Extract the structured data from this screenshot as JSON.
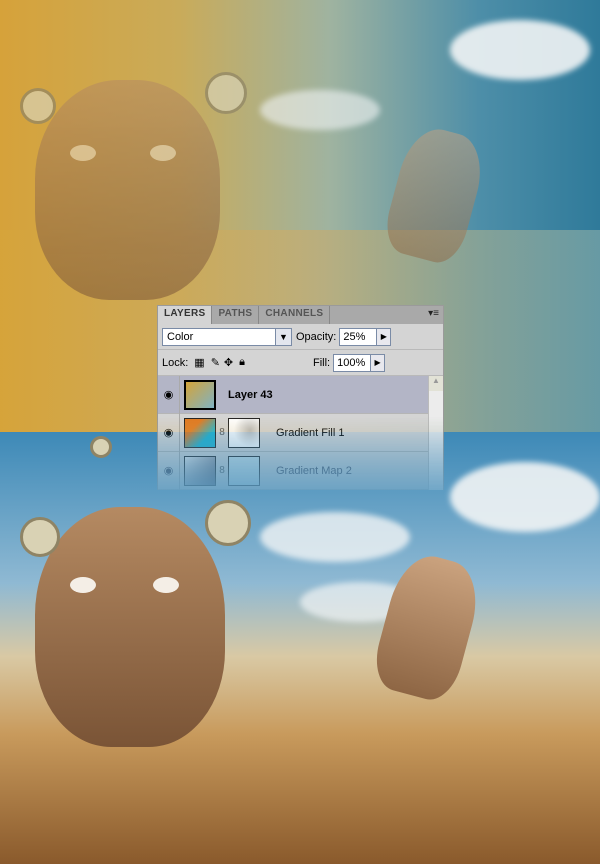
{
  "panel": {
    "tabs": [
      {
        "label": "LAYERS",
        "active": true
      },
      {
        "label": "PATHS",
        "active": false
      },
      {
        "label": "CHANNELS",
        "active": false
      }
    ],
    "menu_icon": "panel-menu-icon",
    "blend_mode": "Color",
    "opacity_label": "Opacity:",
    "opacity_value": "25%",
    "lock_label": "Lock:",
    "fill_label": "Fill:",
    "fill_value": "100%",
    "layers": [
      {
        "name": "Layer 43",
        "visible": true,
        "selected": true
      },
      {
        "name": "Gradient Fill 1",
        "visible": true,
        "selected": false
      },
      {
        "name": "Gradient Map 2",
        "visible": true,
        "selected": false
      }
    ]
  },
  "colors": {
    "selected_row": "#b3b5c6",
    "gradient_fill_start": "#e07a22",
    "gradient_fill_end": "#1fb4d0"
  }
}
